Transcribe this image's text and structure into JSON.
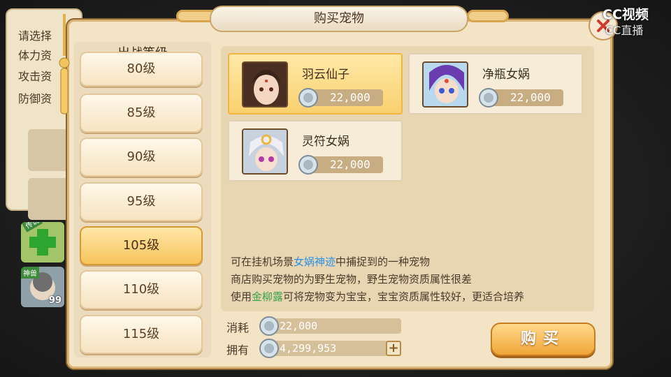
{
  "background_panel": {
    "lines": [
      "请选择",
      "体力资",
      "攻击资",
      "防御资"
    ],
    "thumb_tags": [
      "传说",
      "神兽"
    ],
    "thumb_level": "99"
  },
  "dialog": {
    "title": "购买宠物"
  },
  "watermark": {
    "line1": "CC视频",
    "line2": "CC直播"
  },
  "level_list": {
    "header": "出战等级",
    "items": [
      "80级",
      "85级",
      "90级",
      "95级",
      "105级",
      "110级",
      "115级"
    ],
    "active_index": 4
  },
  "pets": [
    {
      "name": "羽云仙子",
      "price": "22,000",
      "selected": true
    },
    {
      "name": "净瓶女娲",
      "price": "22,000",
      "selected": false
    },
    {
      "name": "灵符女娲",
      "price": "22,000",
      "selected": false
    }
  ],
  "description": {
    "line1_pre": "可在挂机场景",
    "line1_hl": "女娲神迹",
    "line1_post": "中捕捉到的一种宠物",
    "line2": "商店购买宠物的为野生宠物，野生宠物资质属性很差",
    "line3_pre": "使用",
    "line3_hl": "金柳露",
    "line3_post": "可将宠物变为宝宝，宝宝资质属性较好，更适合培养"
  },
  "purchase": {
    "cost_label": "消耗",
    "cost_value": "22,000",
    "own_label": "拥有",
    "own_value": "4,299,953",
    "add_symbol": "+",
    "buy_label": "购买"
  },
  "colors": {
    "accent_gold": "#f8c45c",
    "highlight_blue": "#2a8fe6",
    "highlight_green": "#3aa24a"
  },
  "icons": {
    "close": "close-icon",
    "coin": "silver-coin-icon",
    "add": "plus-icon"
  }
}
